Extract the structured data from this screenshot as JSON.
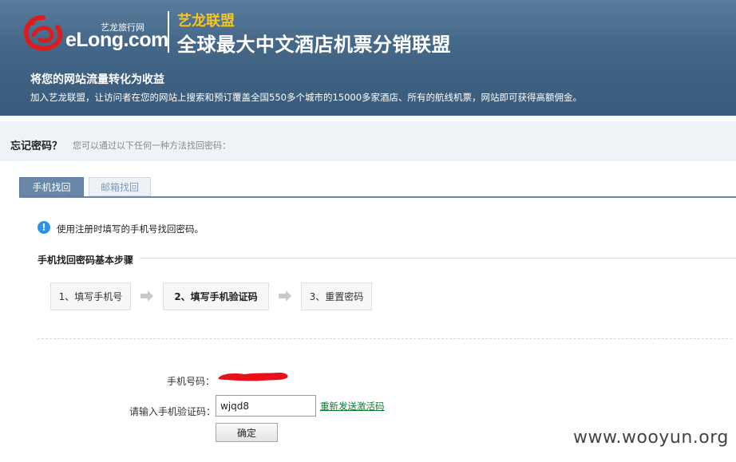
{
  "header": {
    "brand_small": "艺龙旅行网",
    "brand": "eLong.com",
    "alliance_title": "艺龙联盟",
    "slogan": "全球最大中文酒店机票分销联盟",
    "sub_title": "将您的网站流量转化为收益",
    "sub_desc": "加入艺龙联盟，让访问者在您的网站上搜索和预订覆盖全国550多个城市的15000多家酒店、所有的航线机票，网站即可获得高额佣金。"
  },
  "forgot": {
    "title": "忘记密码？",
    "hint": "您可以通过以下任何一种方法找回密码："
  },
  "tabs": [
    {
      "label": "手机找回",
      "active": true
    },
    {
      "label": "邮箱找回",
      "active": false
    }
  ],
  "info": {
    "icon": "info-icon",
    "text": "使用注册时填写的手机号找回密码。"
  },
  "steps": {
    "title": "手机找回密码基本步骤",
    "items": [
      {
        "label": "1、填写手机号"
      },
      {
        "label": "2、填写手机验证码"
      },
      {
        "label": "3、重置密码"
      }
    ]
  },
  "form": {
    "phone_label": "手机号码：",
    "code_label": "请输入手机验证码：",
    "code_value": "wjqd8",
    "resend_link": "重新发送激活码",
    "confirm_button": "确定"
  },
  "watermark": "www.wooyun.org",
  "colors": {
    "banner": "#46698a",
    "alliance": "#f7c51e",
    "tab_active": "#6988a8",
    "link": "#0a7a2f",
    "redaction": "#e8101a"
  }
}
